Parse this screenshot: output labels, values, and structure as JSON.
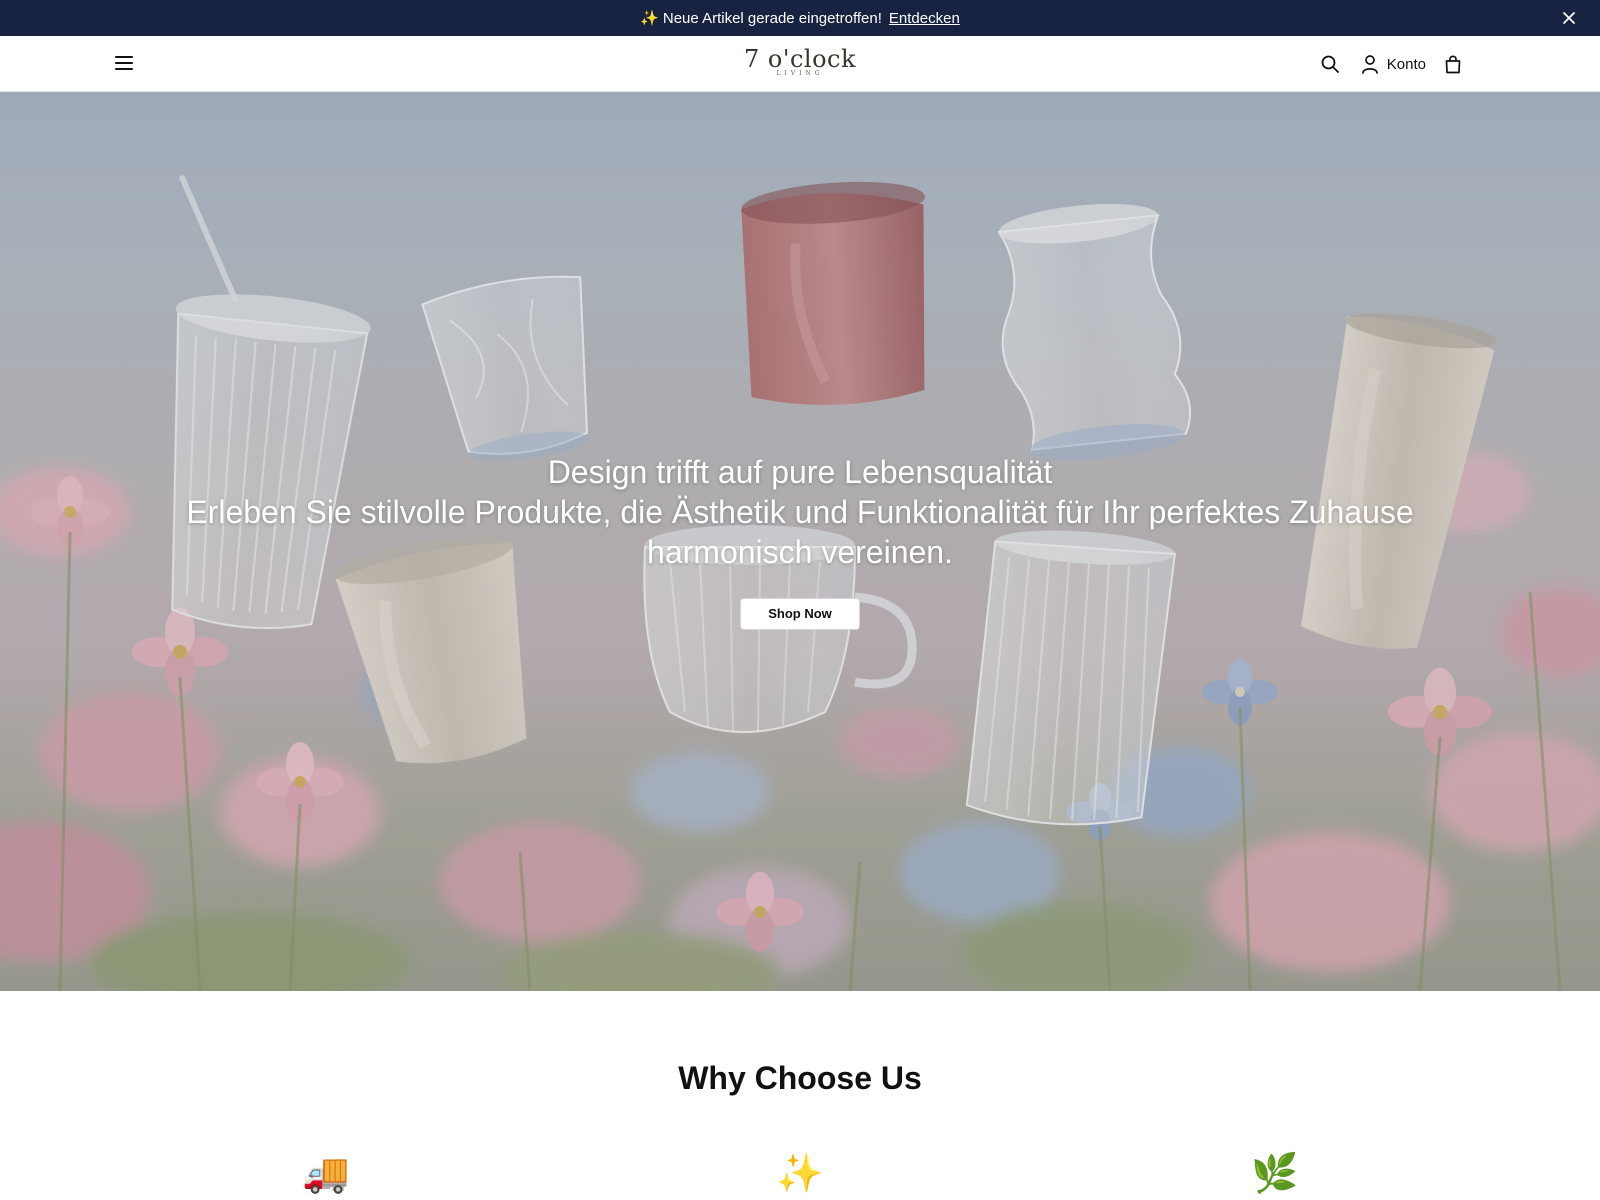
{
  "announcement": {
    "sparkle": "✨",
    "text": "Neue Artikel gerade eingetroffen!",
    "link_label": "Entdecken"
  },
  "header": {
    "logo_main": "7 o'clock",
    "logo_sub": "LIVING",
    "account_label": "Konto"
  },
  "hero": {
    "title": "Design trifft auf pure Lebensqualität",
    "subtitle": "Erleben Sie stilvolle Produkte, die Ästhetik und Funktionalität für Ihr perfektes Zuhause harmonisch vereinen.",
    "cta_label": "Shop Now"
  },
  "why": {
    "title": "Why Choose Us",
    "features": [
      {
        "icon": "🚚"
      },
      {
        "icon": "✨"
      },
      {
        "icon": "🌿"
      }
    ]
  },
  "colors": {
    "announcement_bg": "#172340",
    "text_dark": "#111111"
  }
}
